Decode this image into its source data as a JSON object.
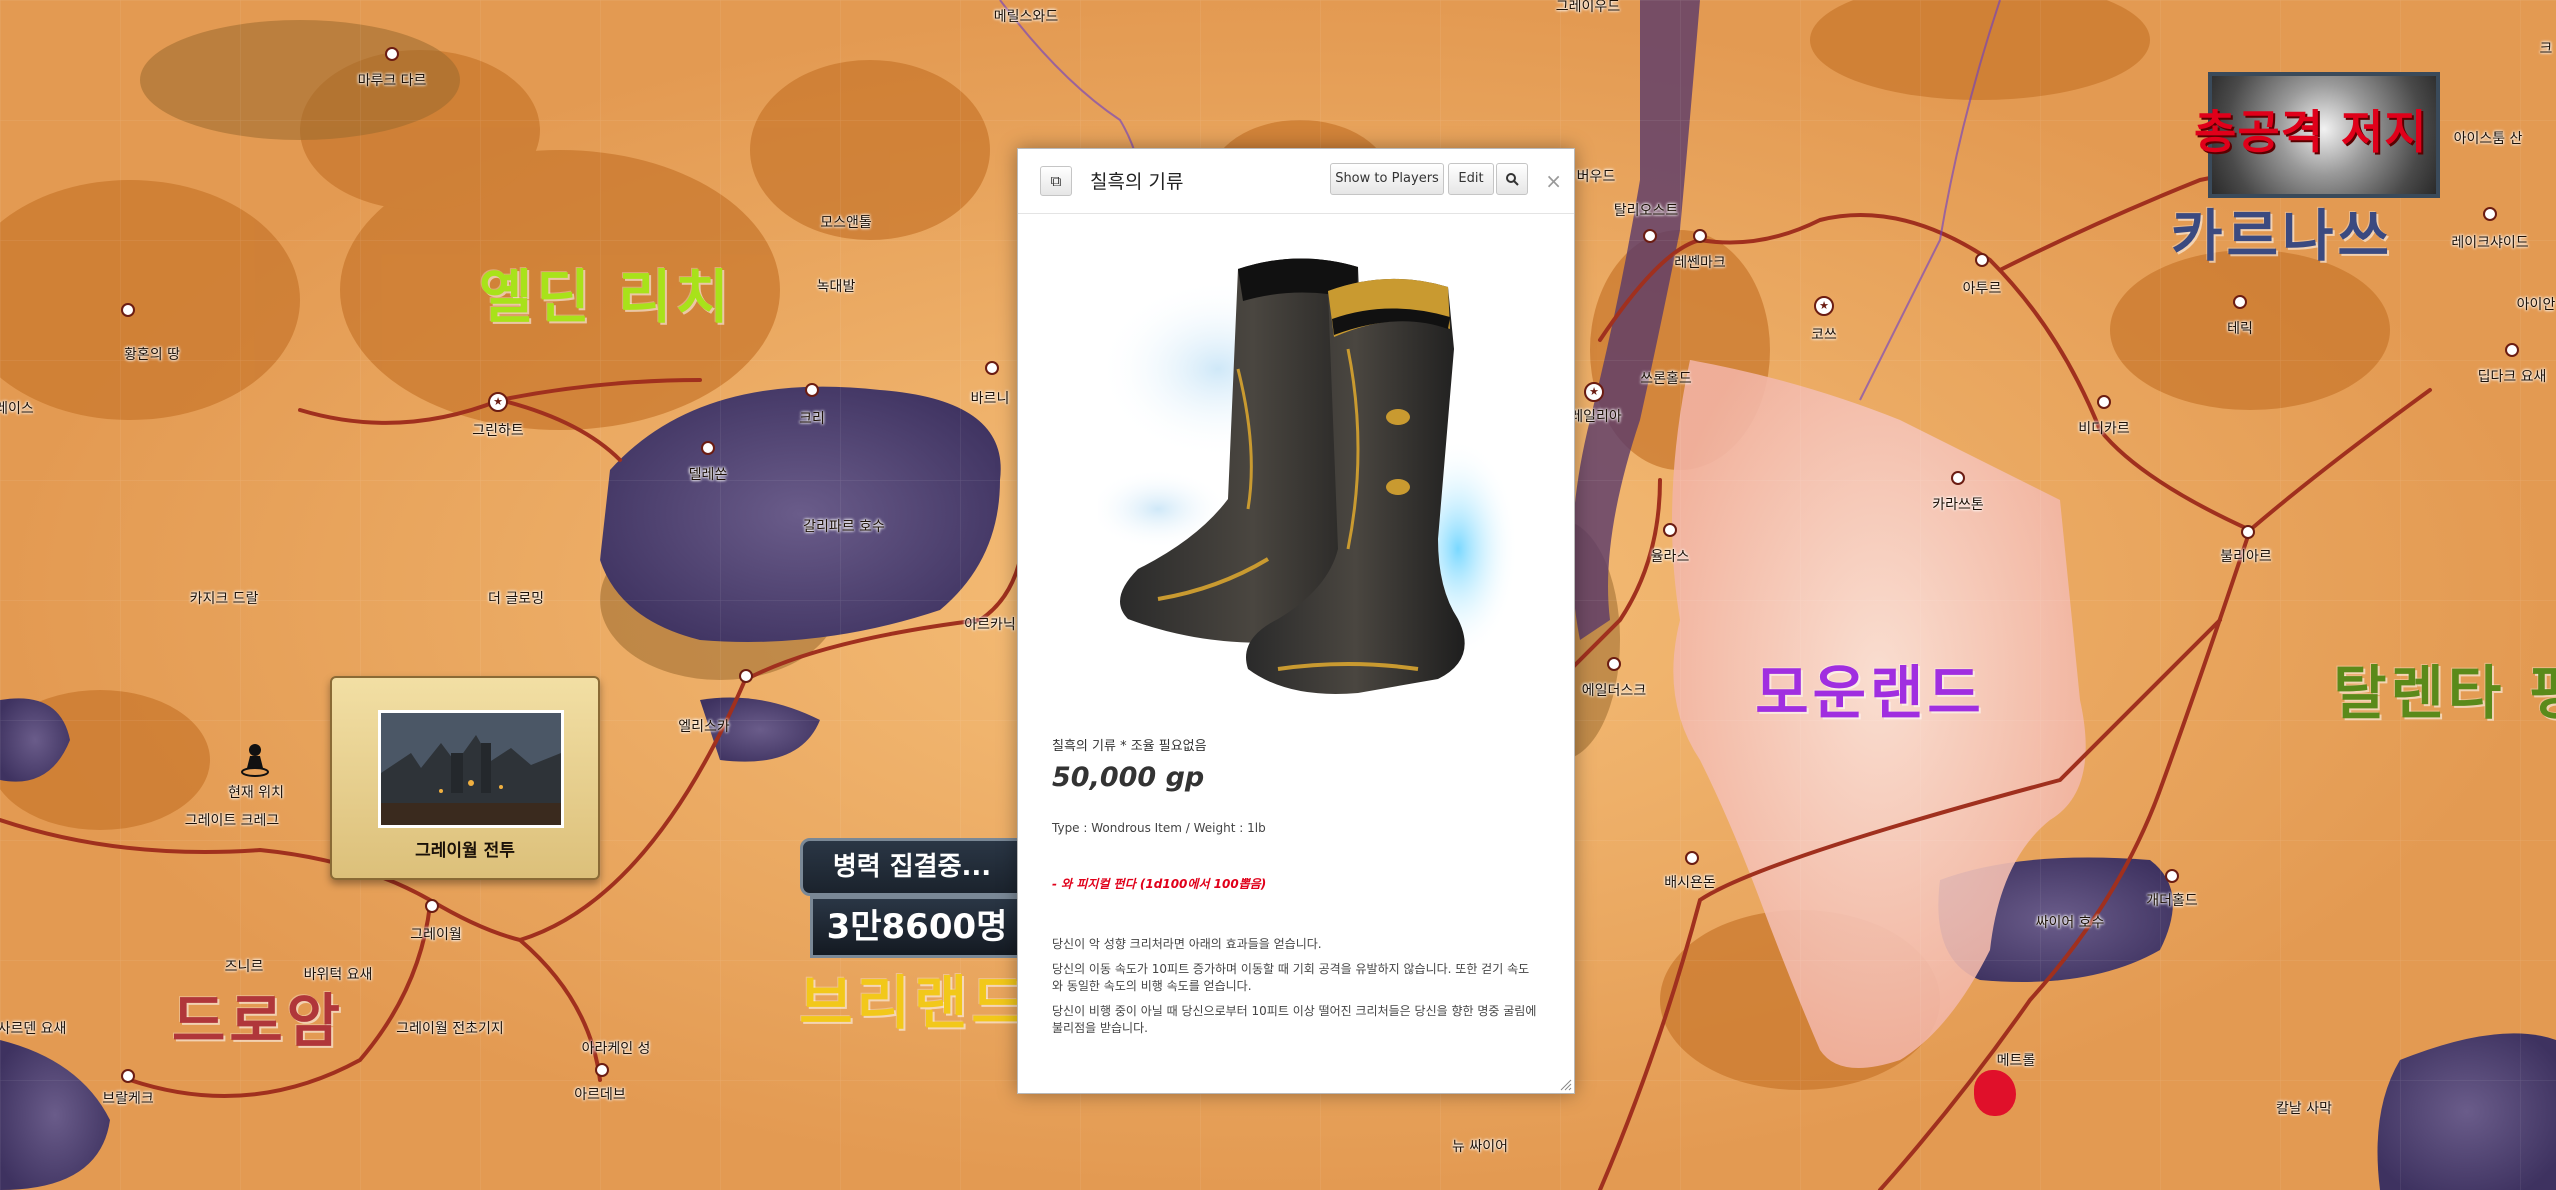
{
  "map": {
    "regions": [
      {
        "id": "eldin",
        "text": "옐딘 리치",
        "color": "#a8e21a",
        "size": 58
      },
      {
        "id": "moonland",
        "text": "모운랜드",
        "color": "#a02ee0",
        "size": 58
      },
      {
        "id": "karnas",
        "text": "카르나쓰",
        "color": "#3b4a80",
        "size": 58
      },
      {
        "id": "talenta",
        "text": "탈렌타 평",
        "color": "#5a8a1a",
        "size": 58
      },
      {
        "id": "drowam",
        "text": "드로암",
        "color": "#b0363a",
        "size": 58
      },
      {
        "id": "brland",
        "text": "브리랜드",
        "color": "#f2c81a",
        "size": 58
      }
    ],
    "places": [
      "메릴스와드",
      "마루크 다르",
      "모스앤톨",
      "녹대발",
      "황혼의 땅",
      "그린하트",
      "크리",
      "바르니",
      "델레쏜",
      "갈리파르 호수",
      "카지크 드랄",
      "더 글로밍",
      "아르카닉",
      "엘리스카",
      "현재 위치",
      "그레이트 크레그",
      "그레이월",
      "즈니르",
      "바위턱 요새",
      "그레이월 전초기지",
      "아라케인 성",
      "아르데브",
      "브랄케크",
      "사르덴 요새",
      "그레이우드",
      "버우드",
      "탈리오스트",
      "레쎈마크",
      "아투르",
      "코쓰",
      "쓰론홀드",
      "레일리아",
      "카라쓰톤",
      "율라스",
      "에일더스크",
      "배시욘돈",
      "개더홀드",
      "싸이어 호수",
      "메트롤",
      "뉴 싸이어",
      "칼날 사막",
      "불리아르",
      "테릭",
      "비디카르",
      "레이크샤이드",
      "아이스툼 산",
      "딥다크 요새",
      "아이안",
      "그레이스",
      "크"
    ],
    "current_location": "현재 위치"
  },
  "battle_card": {
    "caption": "그레이월 전투"
  },
  "army_banner": {
    "line1": "병력 집결중...",
    "line2": "3만8600명"
  },
  "attack_banner": {
    "text": "총공격 저지"
  },
  "modal": {
    "title": "칠흑의 기류",
    "buttons": {
      "show_players": "Show to Players",
      "edit": "Edit",
      "search_icon": "magnifier-icon",
      "popout_icon": "popout-icon"
    },
    "close": "×",
    "item": {
      "subtitle": "칠흑의 기류 * 조율 필요없음",
      "price": "50,000 gp",
      "type_line": "Type : Wondrous Item / Weight : 1lb",
      "red_note": "- 와 피지컬 펀다 (1d100에서 100뽑음)",
      "desc1": "당신이 악 성향 크리처라면 아래의 효과들을 얻습니다.",
      "desc2": "당신의 이동 속도가 10피트 증가하며 이동할 때 기회 공격을 유발하지 않습니다. 또한 걷기 속도와 동일한 속도의 비행 속도를 얻습니다.",
      "desc3": "당신이 비행 중이 아닐 때 당신으로부터 10피트 이상 떨어진 크리처들은 당신을 향한 명중 굴림에 불리점을 받습니다.",
      "image": "black-boots"
    }
  },
  "colors": {
    "ocean": "#5a3a6a",
    "land": "#e9a25a",
    "road": "#a0301e",
    "modal_red": "#e0001a"
  }
}
